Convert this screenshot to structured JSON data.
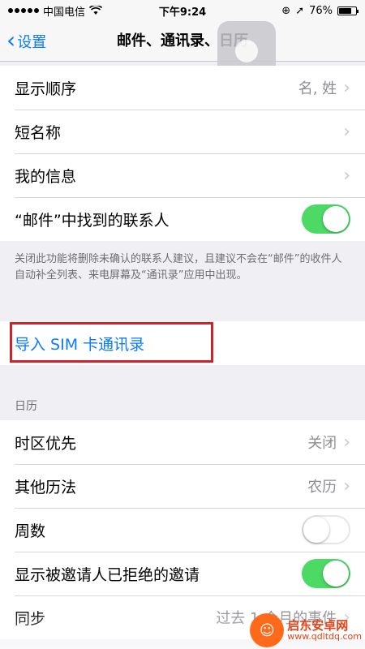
{
  "status_bar": {
    "carrier": "中国电信",
    "time": "下午9:24",
    "battery": "76%",
    "battery_level": 0.76
  },
  "nav": {
    "back_label": "设置",
    "title": "邮件、通讯录、日历"
  },
  "contacts_group": {
    "rows": [
      {
        "label": "显示顺序",
        "detail": "名, 姓"
      },
      {
        "label": "短名称",
        "detail": ""
      },
      {
        "label": "我的信息",
        "detail": ""
      },
      {
        "label": "“邮件”中找到的联系人",
        "toggle": "on"
      }
    ]
  },
  "footnote": "关闭此功能将删除未确认的联系人建议，且建议不会在“邮件”的收件人自动补全列表、来电屏幕及“通讯录”应用中出现。",
  "import_sim_label": "导入 SIM 卡通讯录",
  "calendar_section": {
    "header": "日历",
    "rows": [
      {
        "label": "时区优先",
        "detail": "关闭"
      },
      {
        "label": "其他历法",
        "detail": "农历"
      },
      {
        "label": "周数",
        "toggle": "off"
      },
      {
        "label": "显示被邀请人已拒绝的邀请",
        "toggle": "on"
      },
      {
        "label": "同步",
        "detail": "过去 1 个月的事件"
      }
    ]
  },
  "watermark": {
    "title": "启东安卓网",
    "url": "www.qdltdq.com"
  },
  "colors": {
    "accent": "#0a7aff",
    "toggle_on": "#4cd964",
    "highlight": "#d0222c"
  }
}
